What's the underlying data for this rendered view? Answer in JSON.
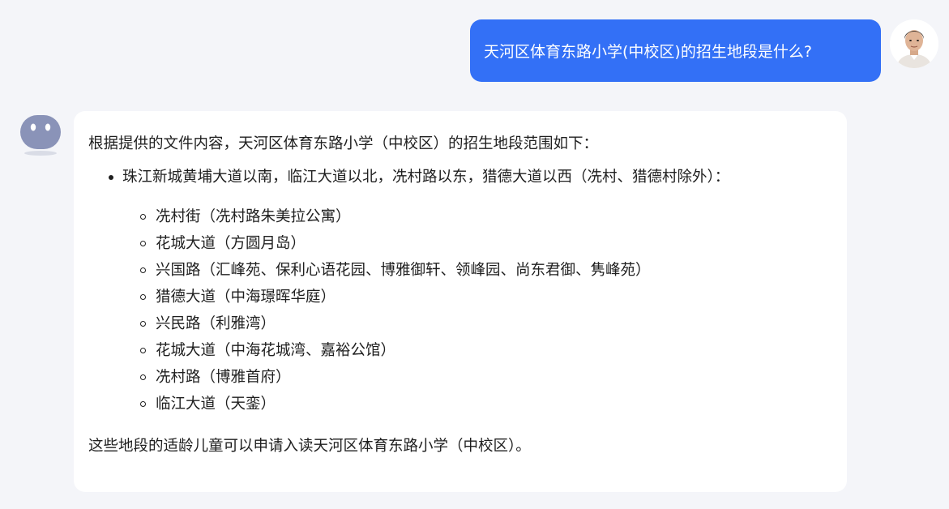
{
  "user": {
    "message": "天河区体育东路小学(中校区)的招生地段是什么?",
    "avatar_icon": "user-avatar-photo"
  },
  "bot": {
    "avatar_icon": "robot-icon",
    "intro": "根据提供的文件内容，天河区体育东路小学（中校区）的招生地段范围如下：",
    "main_item": "珠江新城黄埔大道以南，临江大道以北，冼村路以东，猎德大道以西（冼村、猎德村除外）：",
    "sub_items": [
      "冼村街（冼村路朱美拉公寓）",
      "花城大道（方圆月岛）",
      "兴国路（汇峰苑、保利心语花园、博雅御轩、领峰园、尚东君御、隽峰苑）",
      "猎德大道（中海璟晖华庭）",
      "兴民路（利雅湾）",
      "花城大道（中海花城湾、嘉裕公馆）",
      "冼村路（博雅首府）",
      "临江大道（天銮）"
    ],
    "outro": "这些地段的适龄儿童可以申请入读天河区体育东路小学（中校区）。"
  },
  "colors": {
    "page_bg": "#f4f5f9",
    "user_bubble": "#3370f6",
    "bot_bubble": "#ffffff",
    "robot_face": "#8a93b8"
  }
}
